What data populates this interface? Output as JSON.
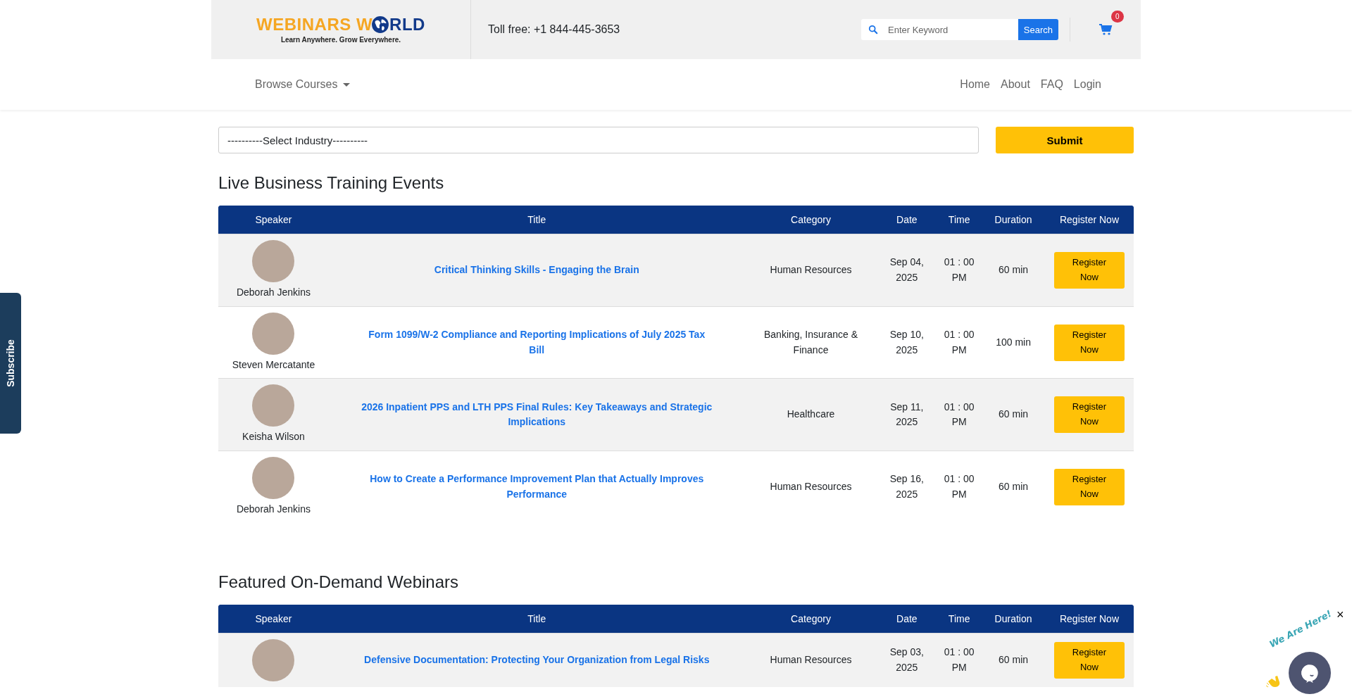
{
  "header": {
    "logo": {
      "left": "WEBINARS W",
      "right": "RLD",
      "tagline": "Learn Anywhere. Grow Everywhere."
    },
    "toll_free": "Toll free: +1 844-445-3653",
    "search": {
      "placeholder": "Enter Keyword",
      "button": "Search"
    },
    "cart": {
      "count": "0"
    }
  },
  "nav": {
    "browse": "Browse Courses",
    "links": [
      "Home",
      "About",
      "FAQ",
      "Login"
    ]
  },
  "filter": {
    "select": "----------Select Industry----------",
    "button": "Submit"
  },
  "sections": [
    {
      "title": "Live Business Training Events",
      "columns": [
        "Speaker",
        "Title",
        "Category",
        "Date",
        "Time",
        "Duration",
        "Register Now"
      ],
      "rows": [
        {
          "speaker": "Deborah Jenkins",
          "title": "Critical Thinking Skills - Engaging the Brain",
          "category": "Human Resources",
          "date": "Sep 04, 2025",
          "time": "01 : 00 PM",
          "duration": "60 min",
          "action": "Register Now"
        },
        {
          "speaker": "Steven Mercatante",
          "title": "Form 1099/W-2 Compliance and Reporting Implications of July 2025 Tax Bill",
          "category": "Banking, Insurance & Finance",
          "date": "Sep 10, 2025",
          "time": "01 : 00 PM",
          "duration": "100 min",
          "action": "Register Now"
        },
        {
          "speaker": "Keisha Wilson",
          "title": "2026 Inpatient PPS and LTH PPS Final Rules: Key Takeaways and Strategic Implications",
          "category": "Healthcare",
          "date": "Sep 11, 2025",
          "time": "01 : 00 PM",
          "duration": "60 min",
          "action": "Register Now"
        },
        {
          "speaker": "Deborah Jenkins",
          "title": "How to Create a Performance Improvement Plan that Actually Improves Performance",
          "category": "Human Resources",
          "date": "Sep 16, 2025",
          "time": "01 : 00 PM",
          "duration": "60 min",
          "action": "Register Now"
        }
      ]
    },
    {
      "title": "Featured On-Demand Webinars",
      "columns": [
        "Speaker",
        "Title",
        "Category",
        "Date",
        "Time",
        "Duration",
        "Register Now"
      ],
      "rows": [
        {
          "speaker": "",
          "title": "Defensive Documentation: Protecting Your Organization from Legal Risks",
          "category": "Human Resources",
          "date": "Sep 03, 2025",
          "time": "01 : 00 PM",
          "duration": "60 min",
          "action": "Register Now"
        }
      ]
    }
  ],
  "subscribe_tab": "Subscribe",
  "chat_widget": {
    "banner": "We Are Here!",
    "close": "×"
  }
}
